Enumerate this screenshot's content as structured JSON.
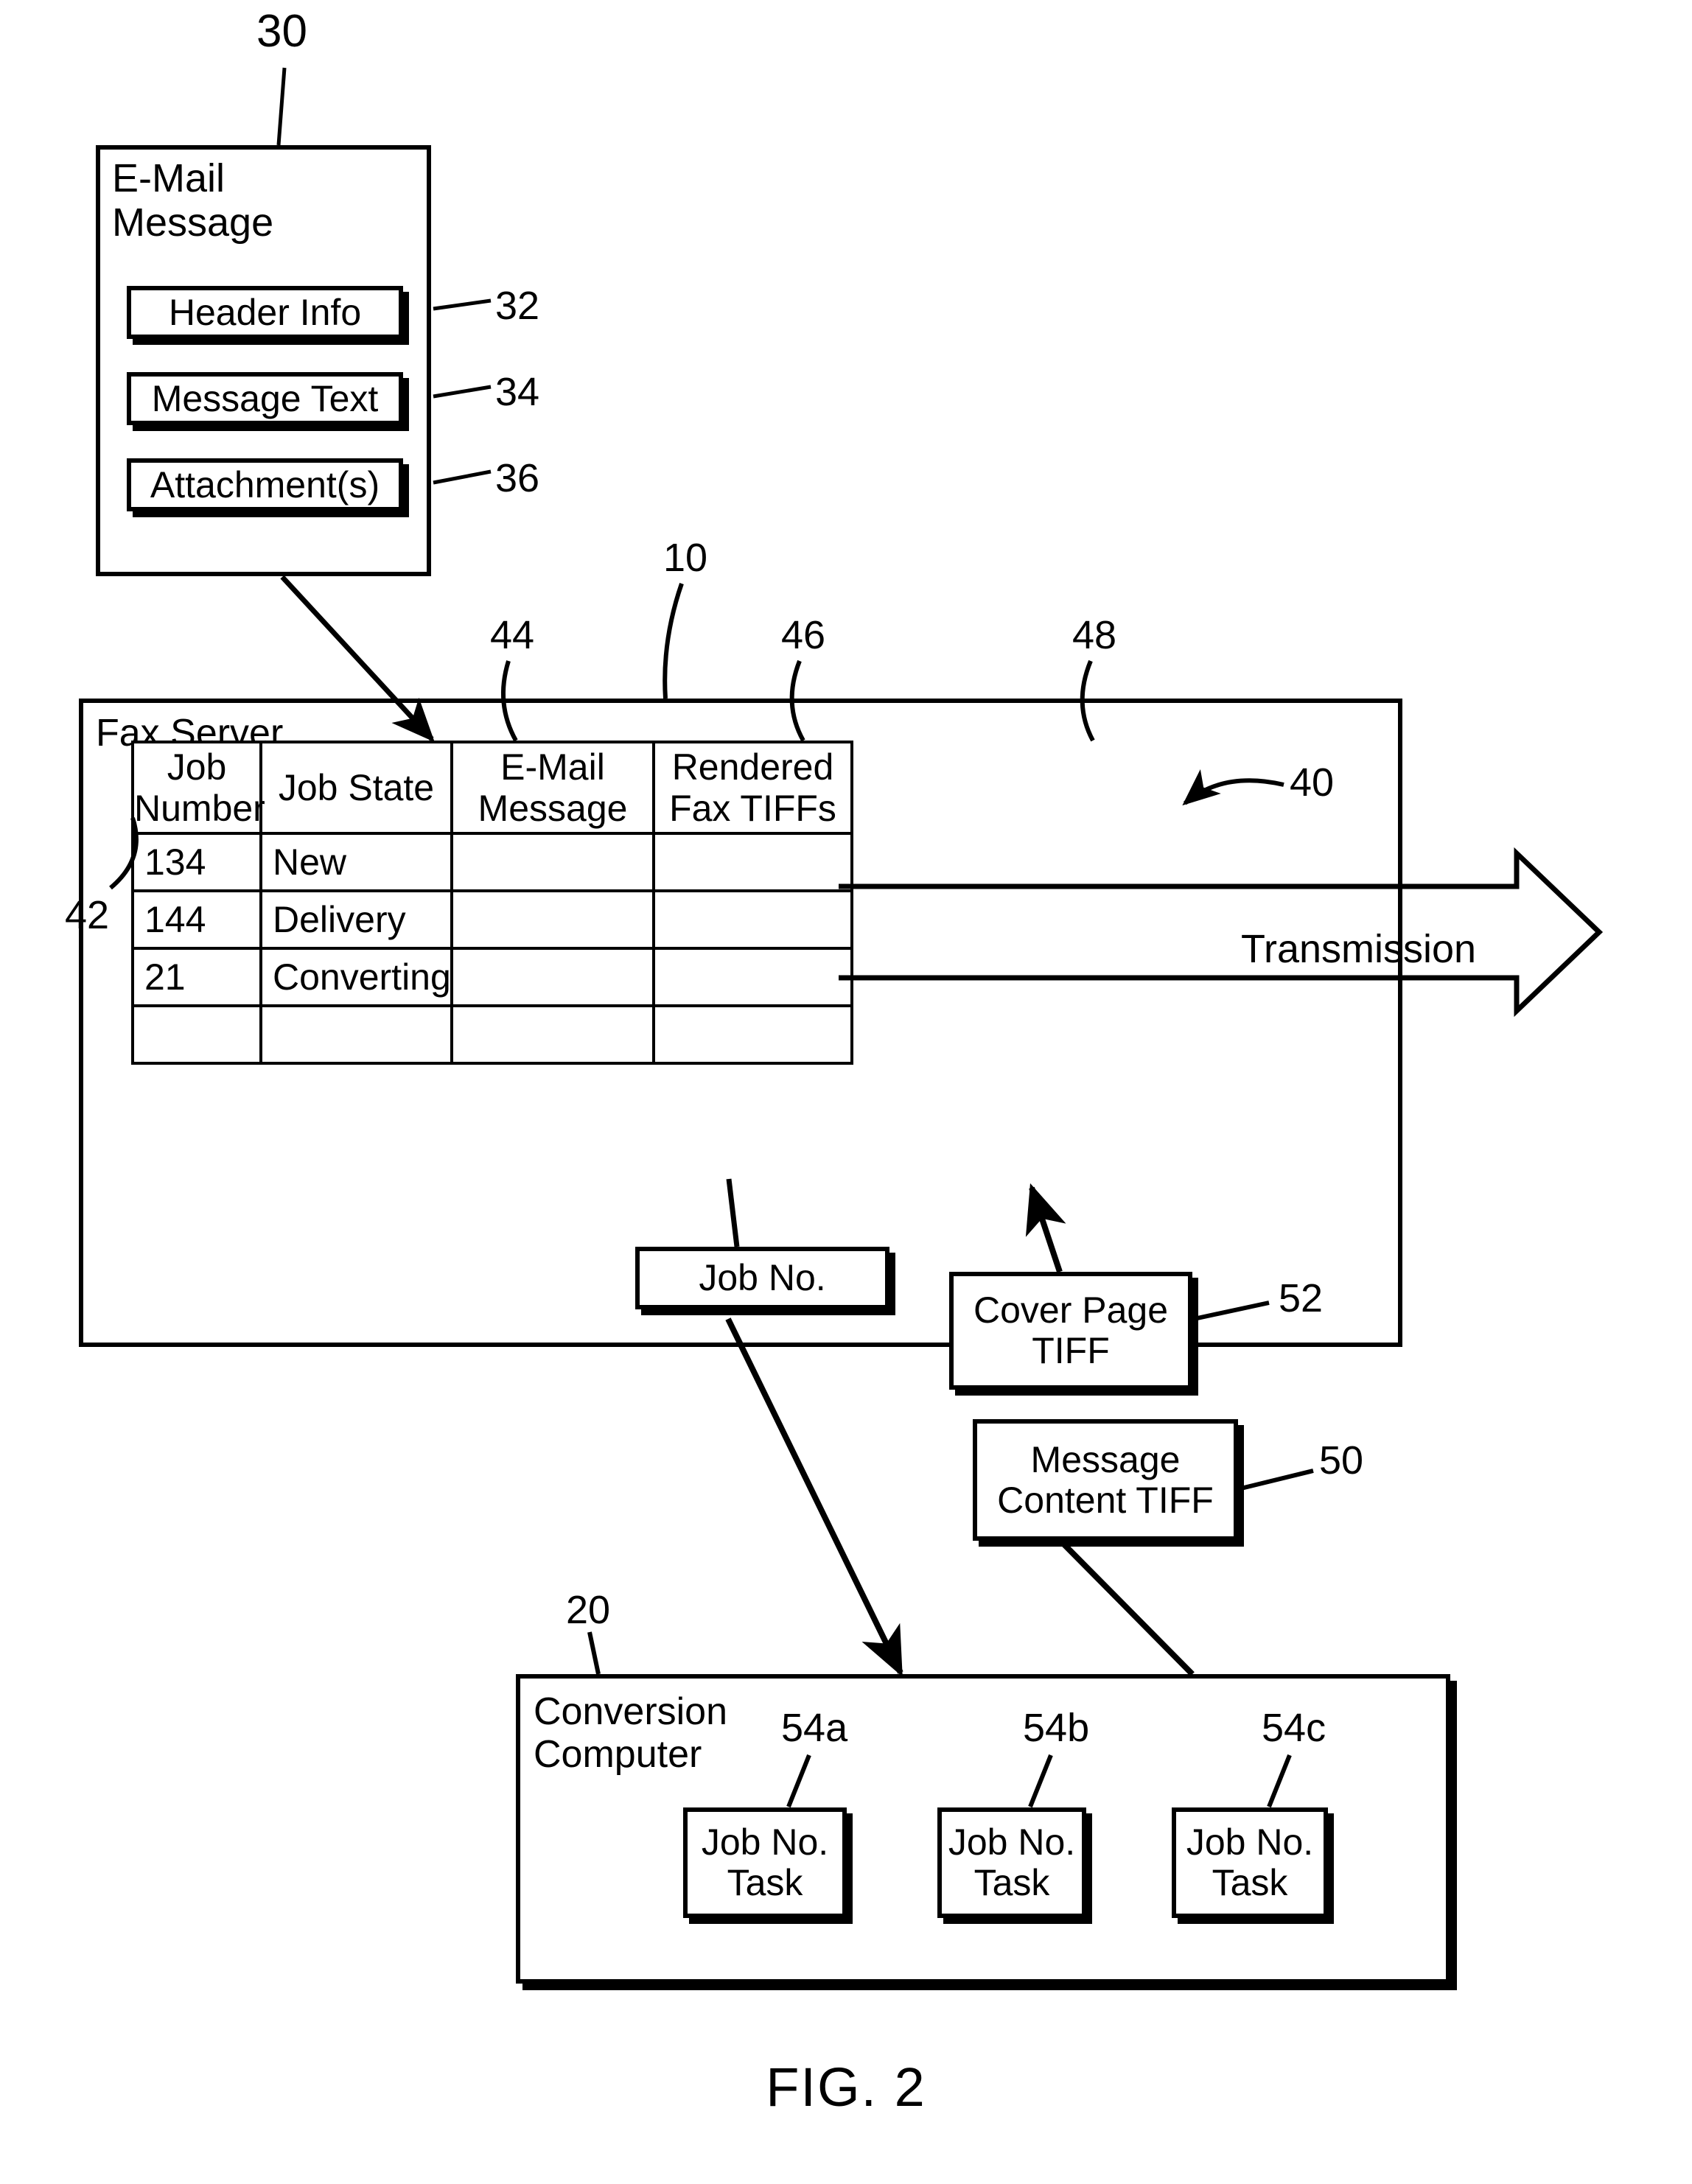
{
  "figure": {
    "caption": "FIG. 2"
  },
  "email_message": {
    "ref": "30",
    "title": "E-Mail\nMessage",
    "items": [
      {
        "label": "Header Info",
        "ref": "32"
      },
      {
        "label": "Message Text",
        "ref": "34"
      },
      {
        "label": "Attachment(s)",
        "ref": "36"
      }
    ]
  },
  "fax_server": {
    "ref": "10",
    "title": "Fax Server",
    "table": {
      "ref": "40",
      "row_ref": "42",
      "column_refs": [
        "44",
        "46",
        "48"
      ],
      "columns": [
        "Job\nNumber",
        "Job State",
        "E-Mail\nMessage",
        "Rendered\nFax TIFFs"
      ],
      "rows": [
        [
          "134",
          "New",
          "",
          ""
        ],
        [
          "144",
          "Delivery",
          "",
          ""
        ],
        [
          "21",
          "Converting",
          "",
          ""
        ],
        [
          "",
          "",
          "",
          ""
        ]
      ]
    },
    "transmission_label": "Transmission"
  },
  "artifacts": {
    "job_no": {
      "label": "Job No."
    },
    "cover_page_tiff": {
      "label": "Cover Page\nTIFF",
      "ref": "52"
    },
    "message_content_tiff": {
      "label": "Message\nContent TIFF",
      "ref": "50"
    }
  },
  "conversion_computer": {
    "ref": "20",
    "title": "Conversion\nComputer",
    "tasks": [
      {
        "label": "Job No.\nTask",
        "ref": "54a"
      },
      {
        "label": "Job No.\nTask",
        "ref": "54b"
      },
      {
        "label": "Job No.\nTask",
        "ref": "54c"
      }
    ]
  }
}
